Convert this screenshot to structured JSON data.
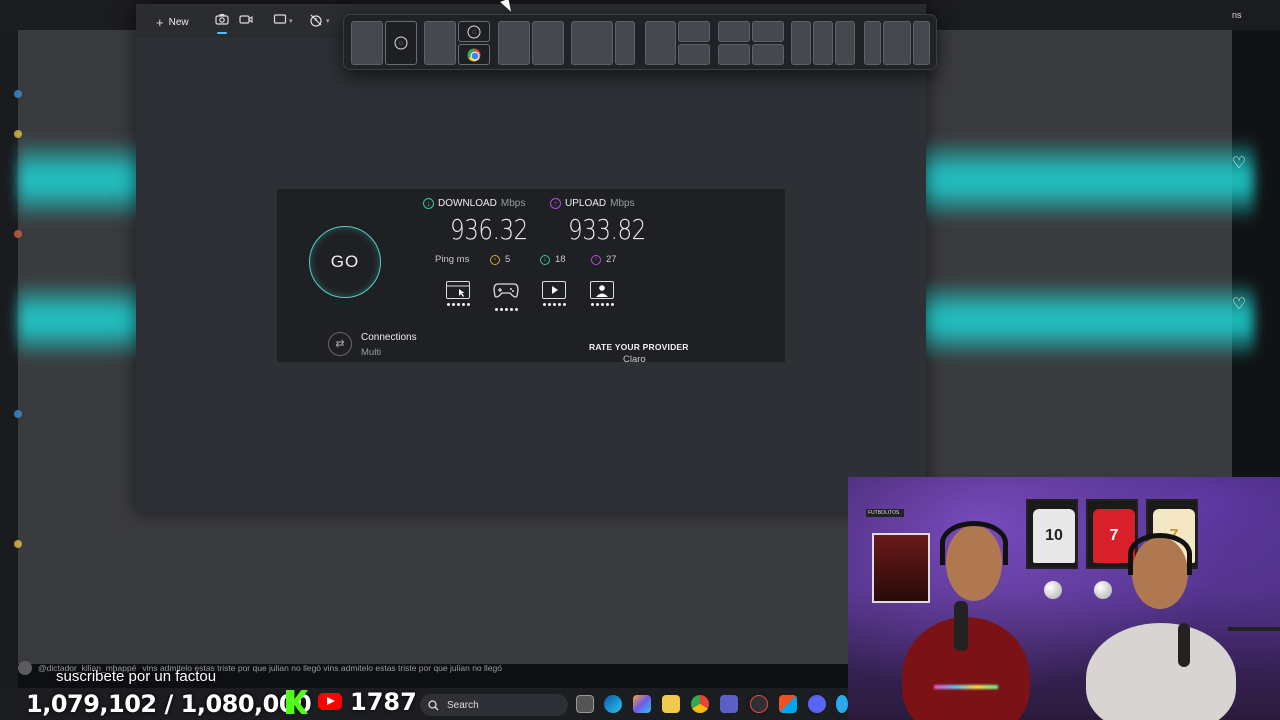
{
  "background": {
    "top_right_label": "ns",
    "accent_cyan": "#1fd3d3"
  },
  "snipping_tool": {
    "new_label": "New",
    "toolbar_icons": [
      "camera-icon",
      "video-icon",
      "rectangle-mode-icon",
      "timer-icon"
    ],
    "snap_layouts": [
      "layout-half",
      "layout-half-stacked",
      "layout-two-equal",
      "layout-two-wide-left",
      "layout-left-two-right",
      "layout-grid-four",
      "layout-three-columns",
      "layout-three-columns-wide"
    ]
  },
  "speedtest": {
    "go_label": "GO",
    "download": {
      "label": "DOWNLOAD",
      "unit": "Mbps",
      "value": "936.32"
    },
    "upload": {
      "label": "UPLOAD",
      "unit": "Mbps",
      "value": "933.82"
    },
    "ping": {
      "label": "Ping",
      "unit": "ms",
      "idle": "5",
      "down": "18",
      "up": "27"
    },
    "use_cases": [
      "browsing-icon",
      "gaming-icon",
      "streaming-icon",
      "video-call-icon"
    ],
    "connections": {
      "label": "Connections",
      "value": "Multi"
    },
    "rate_provider": {
      "label": "RATE YOUR PROVIDER",
      "provider": "Claro"
    },
    "colors": {
      "download": "#36c5a5",
      "upload": "#b14fd8",
      "ring": "#4fd1c5"
    }
  },
  "overlay": {
    "chat_user": "@dictador_kilian_mbappé",
    "chat_message": "vins admitelo estas triste por que julian no llegó vins admitelo estas triste por que julian no llegó",
    "subtitle": "suscribete por un factou",
    "counter": "1,079,102",
    "counter_goal": "/ 1,080,000",
    "youtube_count": "1787"
  },
  "taskbar": {
    "search_placeholder": "Search",
    "apps": [
      "task-view-icon",
      "edge-icon",
      "copilot-icon",
      "file-explorer-icon",
      "chrome-icon",
      "teams-icon",
      "snipping-tool-icon",
      "store-icon",
      "discord-icon",
      "telegram-icon"
    ]
  },
  "webcam": {
    "banner": "FUTBOLITOS",
    "jersey_numbers": [
      "10",
      "7",
      "7"
    ]
  }
}
